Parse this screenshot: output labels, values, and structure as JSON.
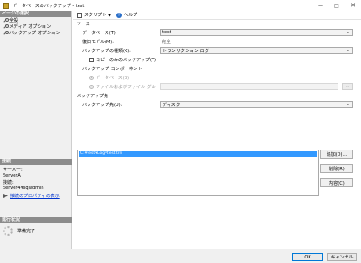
{
  "window": {
    "title": "データベースのバックアップ - test",
    "icon": "database-backup-icon",
    "controls": [
      "minimize-icon",
      "maximize-icon",
      "close-icon"
    ]
  },
  "left_pane": {
    "pages_header": "ページの選択",
    "pages": [
      {
        "label": "全般",
        "icon": "wrench-icon"
      },
      {
        "label": "メディア オプション",
        "icon": "wrench-icon"
      },
      {
        "label": "バックアップ オプション",
        "icon": "wrench-icon"
      }
    ],
    "connection_header": "接続",
    "server_label": "サーバー:",
    "server_value": "ServerA",
    "connection_label": "接続:",
    "connection_value": "Server4¥sqladmin",
    "view_conn_props": "接続のプロパティの表示",
    "progress_header": "進行状況",
    "progress_status": "準備完了"
  },
  "toolbar": {
    "script_label": "スクリプト",
    "help_label": "ヘルプ"
  },
  "source": {
    "section_label": "ソース",
    "database_label": "データベース(T):",
    "database_value": "test",
    "recovery_model_label": "復旧モデル(M):",
    "recovery_model_value": "完全",
    "backup_type_label": "バックアップの種類(K):",
    "backup_type_value": "トランザクション ログ",
    "copy_only_label": "コピーのみのバックアップ(Y)",
    "component_label": "バックアップ コンポーネント:",
    "component_database_label": "データベース(B)",
    "component_files_label": "ファイルおよびファイル グループ(G):",
    "browse_label": "..."
  },
  "destination": {
    "section_label": "バックアップ先",
    "backup_to_label": "バックアップ先(U):",
    "backup_to_value": "ディスク",
    "items": [
      "C:¥test¥Log¥test.trn"
    ],
    "add_label": "追加(D)...",
    "remove_label": "削除(R)",
    "contents_label": "内容(C)"
  },
  "footer": {
    "ok_label": "OK",
    "cancel_label": "キャンセル"
  }
}
